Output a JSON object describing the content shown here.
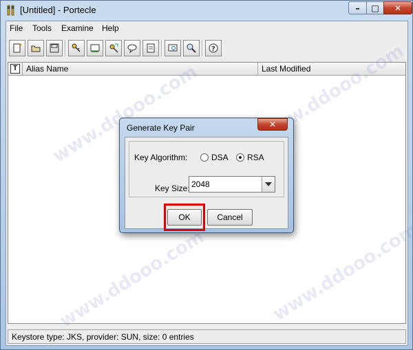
{
  "window": {
    "title": "[Untitled] - Portecle",
    "controls": {
      "minimize": "–",
      "maximize": "□",
      "close": "✕"
    }
  },
  "menu": [
    {
      "label": "File"
    },
    {
      "label": "Tools"
    },
    {
      "label": "Examine"
    },
    {
      "label": "Help"
    }
  ],
  "toolbar": {
    "buttons": [
      "new-keystore-icon",
      "open-keystore-icon",
      "save-keystore-icon",
      "generate-key-pair-icon",
      "generate-certificate-icon",
      "import-trusted-icon",
      "import-key-pair-icon",
      "set-password-icon",
      "keystore-report-icon",
      "examine-certificate-icon",
      "examine-crl-icon",
      "help-icon"
    ]
  },
  "table": {
    "columns": [
      {
        "label": "Alias Name"
      },
      {
        "label": "Last Modified"
      }
    ],
    "header_icon": "T"
  },
  "status": "Keystore type: JKS, provider: SUN, size: 0 entries",
  "dialog": {
    "title": "Generate Key Pair",
    "close": "✕",
    "algorithm_label": "Key Algorithm:",
    "options": [
      {
        "label": "DSA",
        "selected": false
      },
      {
        "label": "RSA",
        "selected": true
      }
    ],
    "key_size_label": "Key Size:",
    "key_size_value": "2048",
    "ok_label": "OK",
    "cancel_label": "Cancel"
  },
  "watermark": "www.ddooo.com"
}
